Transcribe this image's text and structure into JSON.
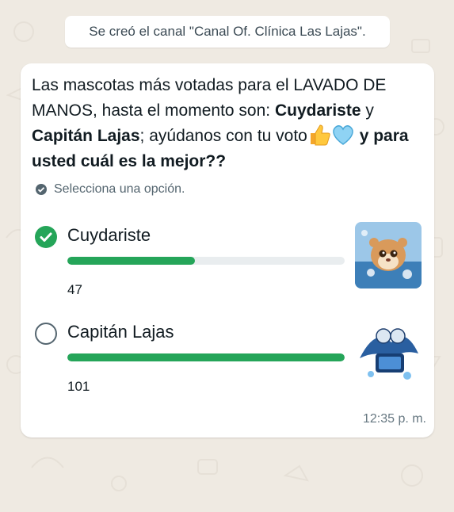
{
  "system_message": "Se creó el canal \"Canal Of. Clínica Las Lajas\".",
  "poll": {
    "question_part1": "Las mascotas más votadas para el LAVADO DE MANOS, hasta el momento son: ",
    "name1": "Cuydariste",
    "joiner": " y ",
    "name2": "Capitán Lajas",
    "question_part2": "; ayúdanos con tu voto",
    "question_part3": " y para usted cuál es la mejor??",
    "hint": "Selecciona una opción.",
    "options": [
      {
        "label": "Cuydariste",
        "votes": "47",
        "selected": true,
        "fill_fraction": 0.46,
        "image": "hamster-mascot-image"
      },
      {
        "label": "Capitán Lajas",
        "votes": "101",
        "selected": false,
        "fill_fraction": 1.0,
        "image": "capitan-lajas-logo-image"
      }
    ],
    "timestamp": "12:35 p. m.",
    "emojis": [
      "thumbs-up-icon",
      "light-blue-heart-icon"
    ]
  },
  "colors": {
    "accent": "#25a559",
    "background": "#efeae2",
    "bubble": "#ffffff"
  }
}
